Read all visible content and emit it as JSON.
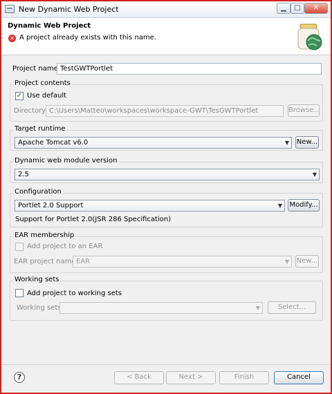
{
  "window": {
    "title": "New Dynamic Web Project"
  },
  "header": {
    "title": "Dynamic Web Project",
    "message": "A project already exists with this name."
  },
  "project_name": {
    "label": "Project name:",
    "value": "TestGWTPortlet"
  },
  "project_contents": {
    "title": "Project contents",
    "use_default_label": "Use default",
    "use_default_checked": true,
    "directory_label": "Directory:",
    "directory_value": "C:\\Users\\Matteo\\workspaces\\workspace-GWT\\TesGWTPortlet",
    "browse_label": "Browse..."
  },
  "target_runtime": {
    "title": "Target runtime",
    "value": "Apache Tomcat v6.0",
    "new_label": "New..."
  },
  "module_version": {
    "title": "Dynamic web module version",
    "value": "2.5"
  },
  "configuration": {
    "title": "Configuration",
    "value": "Portlet 2.0 Support",
    "modify_label": "Modify...",
    "description": "Support for Portlet 2.0(JSR 286 Specification)"
  },
  "ear": {
    "title": "EAR membership",
    "add_label": "Add project to an EAR",
    "name_label": "EAR project name:",
    "name_value": "EAR",
    "new_label": "New..."
  },
  "working_sets": {
    "title": "Working sets",
    "add_label": "Add project to working sets",
    "sets_label": "Working sets:",
    "sets_value": "",
    "select_label": "Select..."
  },
  "buttons": {
    "back": "< Back",
    "next": "Next >",
    "finish": "Finish",
    "cancel": "Cancel"
  },
  "icons": {
    "window": "window-icon",
    "error": "error-icon",
    "banner": "web-project-jar-icon",
    "help": "help-icon",
    "dropdown": "chevron-down-icon"
  },
  "colors": {
    "window_border": "#d21f1f",
    "error": "#d9342b",
    "background": "#f0f0f0"
  }
}
